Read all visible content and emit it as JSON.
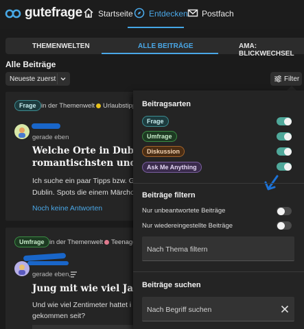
{
  "brand": {
    "name": "gutefrage"
  },
  "nav": [
    {
      "label": "Startseite",
      "icon": "home-icon"
    },
    {
      "label": "Entdecken",
      "icon": "compass-icon",
      "active": true
    },
    {
      "label": "Postfach",
      "icon": "mail-icon"
    }
  ],
  "tabs": [
    {
      "label": "THEMENWELTEN"
    },
    {
      "label": "ALLE BEITRÄGE",
      "active": true
    },
    {
      "label": "AMA: BLICKWECHSEL"
    }
  ],
  "page": {
    "title": "Alle Beiträge",
    "sort_value": "Neueste zuerst",
    "filter_label": "Filter"
  },
  "posts": [
    {
      "type": "Frage",
      "themenwelt_prefix": "in der Themenwelt",
      "themenwelt": "Urlaubstipp",
      "time": "gerade eben",
      "title_line1": "Welche Orte in Dublin w",
      "title_line2": "romantischsten und mi",
      "body_line1": "Ich suche ein paar Tipps bzw. G",
      "body_line2": "Dublin. Spots die einem Märcho",
      "answers": "Noch keine Antworten"
    },
    {
      "type": "Umfrage",
      "themenwelt_prefix": "in der Themenwelt",
      "themenwelt": "Teenage",
      "time": "gerade eben,",
      "title_line1": "Jung mit wie viel Jahre",
      "body_line1": "Und wie viel Zentimeter hattet i",
      "body_line2": "gekommen seit?"
    }
  ],
  "filter_panel": {
    "section_types": "Beitragsarten",
    "types": [
      {
        "label": "Frage",
        "enabled": true
      },
      {
        "label": "Umfrage",
        "enabled": true
      },
      {
        "label": "Diskussion",
        "enabled": true
      },
      {
        "label": "Ask Me Anything",
        "enabled": true
      }
    ],
    "section_filter": "Beiträge filtern",
    "options": [
      {
        "label": "Nur unbeantwortete Beiträge",
        "enabled": false
      },
      {
        "label": "Nur wiedereingestellte Beiträge",
        "enabled": false
      }
    ],
    "topic_placeholder": "Nach Thema filtern",
    "section_search": "Beiträge suchen",
    "search_placeholder": "Nach Begriff suchen"
  },
  "colors": {
    "accent": "#4aa8e8",
    "toggle_on": "#4fa89a",
    "background": "#1b1b1b"
  }
}
